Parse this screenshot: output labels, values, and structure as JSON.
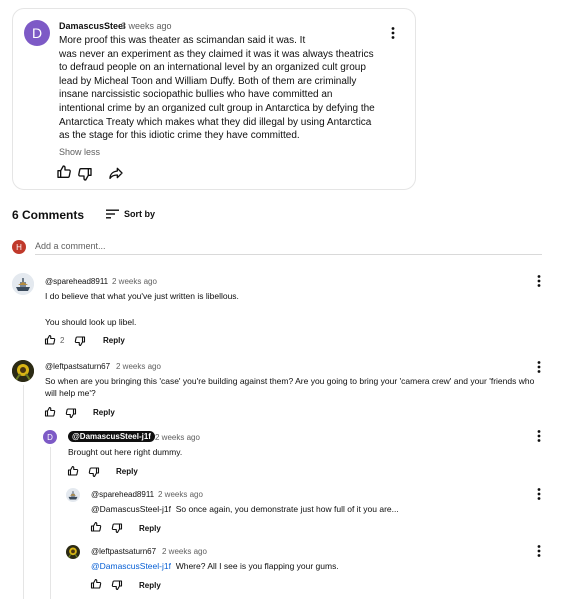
{
  "post": {
    "avatar_letter": "D",
    "author": "DamascusSteel",
    "time": "3 weeks ago",
    "body": "More proof this was theater as scimandan said it was. It\nwas never an experiment as they claimed it was it was always theatrics\nto defraud people on an international level by an organized cult group\nlead by Micheal Toon and William Duffy. Both of them are criminally\ninsane narcissistic sociopathic bullies who have committed an\nintentional crime by an organized cult group in Antarctica by defying the\nAntarctica Treaty which makes what they did illegal by using Antarctica\nas the stage for this idiotic crime they have committed.",
    "show_less": "Show less"
  },
  "comments_header": {
    "count_label": "6 Comments",
    "sort_label": "Sort by"
  },
  "add_comment": {
    "avatar_letter": "H",
    "placeholder": "Add a comment..."
  },
  "comments": [
    {
      "handle": "@sparehead8911",
      "time": "2 weeks ago",
      "lines": [
        "I do believe that what you've just written is libellous.",
        "You should look up libel."
      ],
      "likes": "2",
      "reply": "Reply"
    },
    {
      "handle": "@leftpastsaturn67",
      "time": "2 weeks ago",
      "lines": [
        "So when are you bringing this 'case' you're building against them? Are you going to bring your 'camera crew' and your 'friends who",
        "will help me'?"
      ],
      "reply": "Reply"
    },
    {
      "handle": "@DamascusSteel-j1f",
      "avatar_letter": "D",
      "time": "2 weeks ago",
      "text": "Brought out here right dummy.",
      "reply": "Reply"
    },
    {
      "handle": "@sparehead8911",
      "time": "2 weeks ago",
      "mention": "@DamascusSteel-j1f",
      "text": "So once again, you demonstrate just how full of it you are...",
      "reply": "Reply"
    },
    {
      "handle": "@leftpastsaturn67",
      "time": "2 weeks ago",
      "mention": "@DamascusSteel-j1f",
      "text": "Where? All I see is you flapping your gums.",
      "reply": "Reply"
    }
  ],
  "colors": {
    "post_avatar": "#7d5ac6",
    "user_avatar": "#c0392b",
    "link": "#065fd4",
    "muted": "#606060"
  },
  "icons": [
    "more-vert-icon",
    "thumb-up-icon",
    "thumb-down-icon",
    "share-icon",
    "sort-icon",
    "avatar-ship-icon",
    "avatar-sunflower-icon"
  ]
}
